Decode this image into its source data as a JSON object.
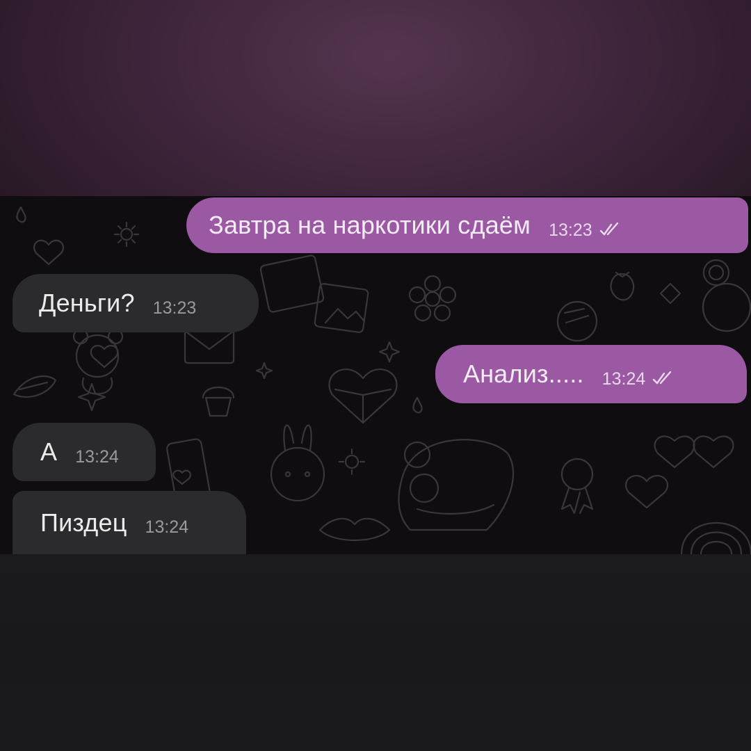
{
  "chat": {
    "messages": [
      {
        "direction": "outgoing",
        "text": "Завтра на наркотики сдаём",
        "time": "13:23",
        "status": "read",
        "status_icon": "double-check-icon"
      },
      {
        "direction": "incoming",
        "text": "Деньги?",
        "time": "13:23"
      },
      {
        "direction": "outgoing",
        "text": "Анализ.....",
        "time": "13:24",
        "status": "read",
        "status_icon": "double-check-icon"
      },
      {
        "direction": "incoming",
        "text": "А",
        "time": "13:24"
      },
      {
        "direction": "incoming",
        "text": "Пиздец",
        "time": "13:24"
      }
    ],
    "colors": {
      "outgoing_bubble": "#9b59a4",
      "incoming_bubble": "#2b2b2e",
      "chat_background": "#0f0d0f",
      "frame_background": "#3a2237"
    },
    "wallpaper_icons": [
      "heart-icon",
      "star-icon",
      "flower-icon",
      "bear-icon",
      "bunny-icon",
      "cake-icon",
      "envelope-icon",
      "photo-icon",
      "rainbow-icon",
      "strawberry-icon",
      "lips-icon",
      "sun-icon",
      "phone-icon",
      "medal-icon",
      "sunglasses-icon"
    ]
  }
}
